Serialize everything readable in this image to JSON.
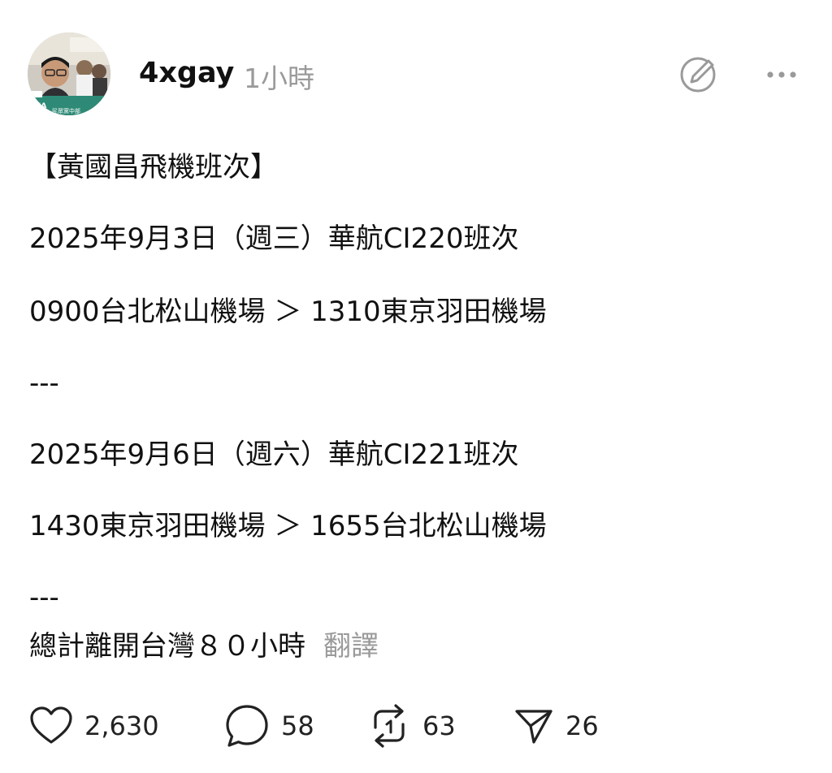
{
  "post": {
    "username": "4xgay",
    "timestamp": "1小時",
    "lines": [
      "【黃國昌飛機班次】",
      "2025年9月3日（週三）華航CI220班次",
      "0900台北松山機場 ＞ 1310東京羽田機場",
      "---",
      "2025年9月6日（週六）華航CI221班次",
      "1430東京羽田機場 ＞ 1655台北松山機場",
      "---",
      "總計離開台灣８０小時"
    ],
    "translate_label": "翻譯"
  },
  "actions": {
    "likes": "2,630",
    "comments": "58",
    "reposts": "63",
    "shares": "26"
  },
  "icons": {
    "like": "heart-icon",
    "comment": "speech-bubble-icon",
    "repost": "repost-arrows-icon",
    "share": "paper-plane-icon",
    "compose": "pencil-circle-icon",
    "more": "ellipsis-icon"
  },
  "colors": {
    "text": "#111111",
    "muted": "#9a9a9a"
  },
  "avatar": {
    "sign_text": "AIA",
    "sign_subtext": "民眾黨中部"
  }
}
